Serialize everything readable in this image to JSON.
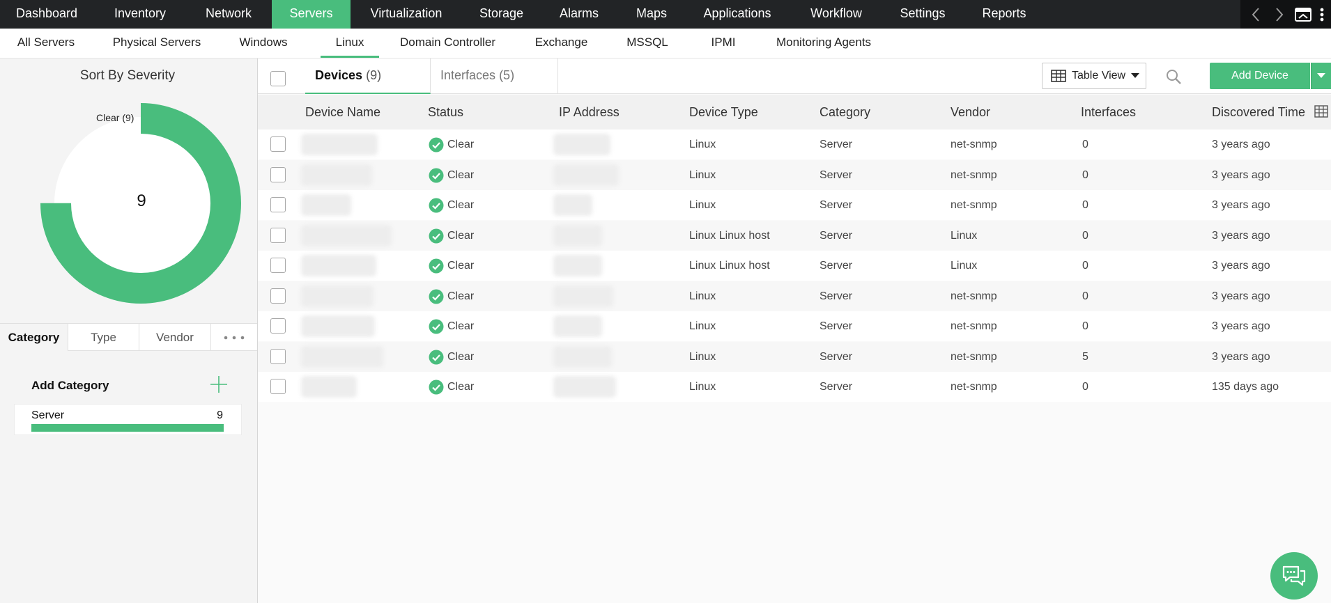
{
  "top_nav": {
    "items": [
      {
        "label": "Dashboard"
      },
      {
        "label": "Inventory"
      },
      {
        "label": "Network"
      },
      {
        "label": "Servers",
        "active": true
      },
      {
        "label": "Virtualization"
      },
      {
        "label": "Storage"
      },
      {
        "label": "Alarms"
      },
      {
        "label": "Maps"
      },
      {
        "label": "Applications"
      },
      {
        "label": "Workflow"
      },
      {
        "label": "Settings"
      },
      {
        "label": "Reports"
      }
    ],
    "controls": [
      "chevron-left-icon",
      "chevron-right-icon",
      "window-icon",
      "more-vertical-icon"
    ]
  },
  "sub_nav": {
    "items": [
      {
        "label": "All Servers"
      },
      {
        "label": "Physical Servers"
      },
      {
        "label": "Windows"
      },
      {
        "label": "Linux",
        "active": true
      },
      {
        "label": "Domain Controller"
      },
      {
        "label": "Exchange"
      },
      {
        "label": "MSSQL"
      },
      {
        "label": "IPMI"
      },
      {
        "label": "Monitoring Agents"
      }
    ]
  },
  "left_panel": {
    "title": "Sort By Severity",
    "donut": {
      "label": "Clear (9)",
      "center_value": "9",
      "segments": [
        {
          "name": "Clear",
          "count": 9,
          "fraction": 0.75,
          "color": "#49bd7d"
        }
      ]
    },
    "filter_tabs": [
      {
        "label": "Category",
        "active": true
      },
      {
        "label": "Type"
      },
      {
        "label": "Vendor"
      }
    ],
    "more_icon": "ellipsis-icon",
    "add_category": {
      "label": "Add Category",
      "icon": "plus-icon"
    },
    "categories": [
      {
        "name": "Server",
        "count": "9",
        "fill_fraction": 1.0
      }
    ]
  },
  "toolbar": {
    "tabs": [
      {
        "label": "Devices",
        "count": "(9)",
        "active": true
      },
      {
        "label": "Interfaces",
        "count": "(5)"
      }
    ],
    "view_button": {
      "label": "Table View",
      "icon": "table-icon"
    },
    "search_icon": "search-icon",
    "add_button": {
      "label": "Add Device"
    }
  },
  "table": {
    "columns": [
      "Device Name",
      "Status",
      "IP Address",
      "Device Type",
      "Category",
      "Vendor",
      "Interfaces",
      "Discovered Time"
    ],
    "rows": [
      {
        "status": "Clear",
        "device_type": "Linux",
        "category": "Server",
        "vendor": "net-snmp",
        "interfaces": "0",
        "discovered": "3 years ago"
      },
      {
        "status": "Clear",
        "device_type": "Linux",
        "category": "Server",
        "vendor": "net-snmp",
        "interfaces": "0",
        "discovered": "3 years ago"
      },
      {
        "status": "Clear",
        "device_type": "Linux",
        "category": "Server",
        "vendor": "net-snmp",
        "interfaces": "0",
        "discovered": "3 years ago"
      },
      {
        "status": "Clear",
        "device_type": "Linux Linux host",
        "category": "Server",
        "vendor": "Linux",
        "interfaces": "0",
        "discovered": "3 years ago"
      },
      {
        "status": "Clear",
        "device_type": "Linux Linux host",
        "category": "Server",
        "vendor": "Linux",
        "interfaces": "0",
        "discovered": "3 years ago"
      },
      {
        "status": "Clear",
        "device_type": "Linux",
        "category": "Server",
        "vendor": "net-snmp",
        "interfaces": "0",
        "discovered": "3 years ago"
      },
      {
        "status": "Clear",
        "device_type": "Linux",
        "category": "Server",
        "vendor": "net-snmp",
        "interfaces": "0",
        "discovered": "3 years ago"
      },
      {
        "status": "Clear",
        "device_type": "Linux",
        "category": "Server",
        "vendor": "net-snmp",
        "interfaces": "5",
        "discovered": "3 years ago"
      },
      {
        "status": "Clear",
        "device_type": "Linux",
        "category": "Server",
        "vendor": "net-snmp",
        "interfaces": "0",
        "discovered": "135 days ago"
      }
    ]
  },
  "chat_icon": "chat-icon",
  "colors": {
    "accent": "#49bd7d",
    "nav_bg": "#222426",
    "status_clear": "#49bd7d"
  }
}
